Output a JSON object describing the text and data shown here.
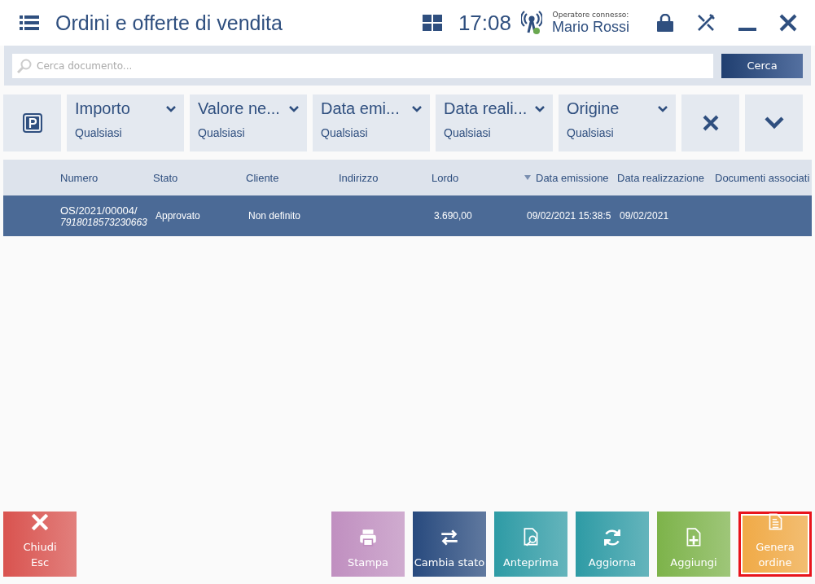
{
  "header": {
    "title": "Ordini e offerte di vendita",
    "time": "17:08",
    "operator_label": "Operatore connesso:",
    "operator": "Mario Rossi"
  },
  "search": {
    "placeholder": "Cerca documento...",
    "button": "Cerca"
  },
  "filters": [
    {
      "label": "Importo",
      "value": "Qualsiasi"
    },
    {
      "label": "Valore ne...",
      "value": "Qualsiasi"
    },
    {
      "label": "Data emi...",
      "value": "Qualsiasi"
    },
    {
      "label": "Data reali...",
      "value": "Qualsiasi"
    },
    {
      "label": "Origine",
      "value": "Qualsiasi"
    }
  ],
  "table": {
    "columns": [
      {
        "label": "Numero",
        "sorted": false
      },
      {
        "label": "Stato",
        "sorted": false
      },
      {
        "label": "Cliente",
        "sorted": false
      },
      {
        "label": "Indirizzo",
        "sorted": false
      },
      {
        "label": "Lordo",
        "sorted": false
      },
      {
        "label": "Data emissione",
        "sorted": true
      },
      {
        "label": "Data realizzazione",
        "sorted": false
      },
      {
        "label": "Documenti associati",
        "sorted": false
      }
    ],
    "rows": [
      {
        "selected": true,
        "cells": [
          {
            "text": "OS/2021/00004/",
            "sub": "7918018573230663"
          },
          {
            "text": "Approvato"
          },
          {
            "text": "Non definito"
          },
          {},
          {
            "text": "3.690,00"
          },
          {
            "text": "09/02/2021 15:38:5"
          },
          {
            "text": "09/02/2021"
          },
          {}
        ]
      }
    ]
  },
  "actions": [
    {
      "kind": "close",
      "label": "Chiudi",
      "shortcut": "Esc",
      "color": "#d9534f",
      "highlighted": false
    },
    {
      "kind": "print",
      "label": "Stampa",
      "color": "#c08fc0",
      "highlighted": false
    },
    {
      "kind": "swap",
      "label": "Cambia stato",
      "color": "#284a7e",
      "highlighted": false
    },
    {
      "kind": "preview",
      "label": "Anteprima",
      "color": "#2e9ba5",
      "highlighted": false
    },
    {
      "kind": "refresh",
      "label": "Aggiorna",
      "color": "#2e9ba5",
      "highlighted": false
    },
    {
      "kind": "add",
      "label": "Aggiungi",
      "color": "#7db34a",
      "highlighted": false
    },
    {
      "kind": "generate",
      "label": "Genera ordine",
      "color": "#f0a944",
      "highlighted": true
    }
  ]
}
